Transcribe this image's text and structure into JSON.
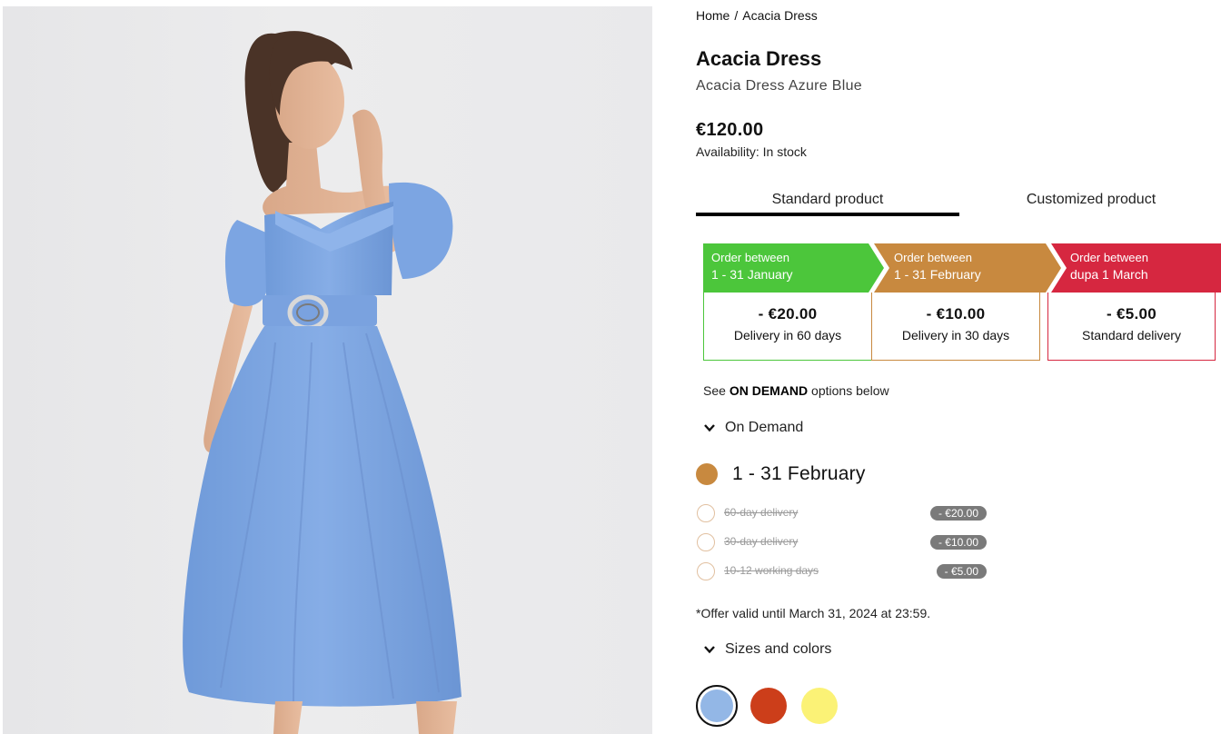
{
  "breadcrumb": {
    "home": "Home",
    "separator": "/",
    "current": "Acacia Dress"
  },
  "product": {
    "title": "Acacia Dress",
    "subtitle": "Acacia Dress Azure Blue",
    "price": "€120.00",
    "availability": "Availability: In stock"
  },
  "tabs": [
    {
      "label": "Standard product",
      "active": true
    },
    {
      "label": "Customized product",
      "active": false
    }
  ],
  "tiers": [
    {
      "line1": "Order between",
      "line2": "1 - 31 January",
      "amount": "- €20.00",
      "delivery": "Delivery in 60 days",
      "color": "#4cc63b"
    },
    {
      "line1": "Order between",
      "line2": "1 - 31 February",
      "amount": "- €10.00",
      "delivery": "Delivery in 30 days",
      "color": "#c8893f"
    },
    {
      "line1": "Order between",
      "line2": "dupa 1 March",
      "amount": "- €5.00",
      "delivery": "Standard delivery",
      "color": "#d62740"
    }
  ],
  "see_options": {
    "prefix": "See",
    "bold": "ON DEMAND",
    "suffix": "options below"
  },
  "on_demand": {
    "label": "On Demand",
    "period": "1 - 31 February",
    "period_color": "#c8893f",
    "options": [
      {
        "label": "60-day delivery",
        "discount": "- €20.00"
      },
      {
        "label": "30-day delivery",
        "discount": "- €10.00"
      },
      {
        "label": "10-12 working days",
        "discount": "- €5.00"
      }
    ]
  },
  "offer_note": "*Offer valid until March 31, 2024 at 23:59.",
  "sizes_colors": {
    "label": "Sizes and colors",
    "swatches": [
      {
        "name": "azure-blue",
        "color": "#93b7e6",
        "selected": true
      },
      {
        "name": "red",
        "color": "#cc3e1a",
        "selected": false
      },
      {
        "name": "yellow",
        "color": "#fbf276",
        "selected": false
      }
    ]
  },
  "icons": {
    "accordion": "chevron-down-icon"
  }
}
